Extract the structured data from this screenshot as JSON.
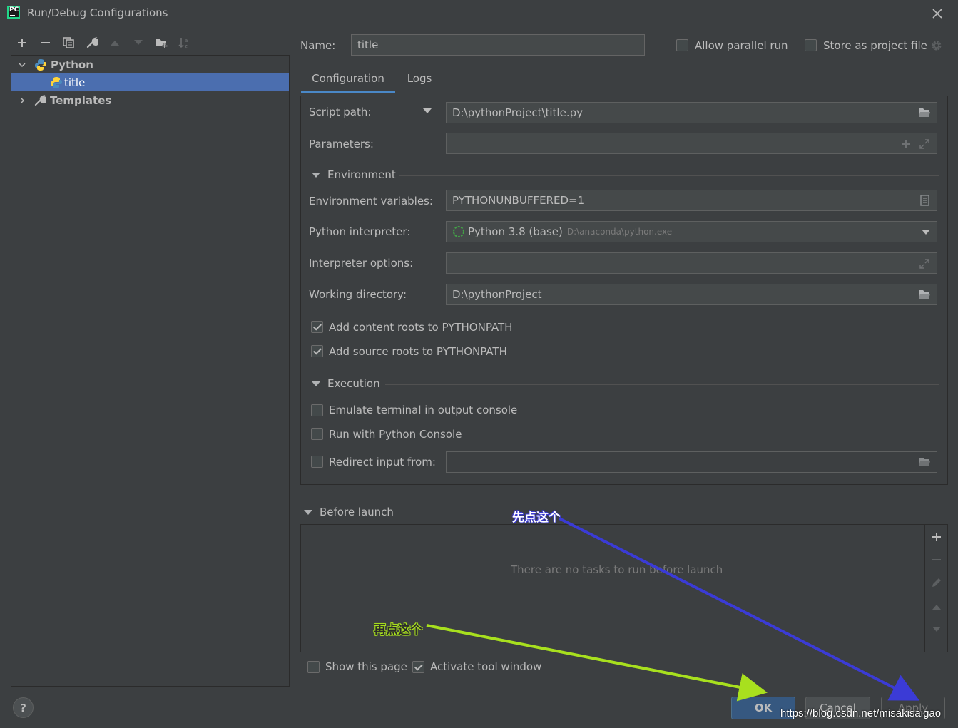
{
  "window": {
    "title": "Run/Debug Configurations",
    "app_logo": "PC"
  },
  "toolbar": {
    "icons": [
      "plus-icon",
      "minus-icon",
      "copy-icon",
      "wrench-icon",
      "arrow-up-icon",
      "arrow-down-icon",
      "folder-add-icon",
      "sort-icon"
    ]
  },
  "tree": {
    "python_label": "Python",
    "title_label": "title",
    "templates_label": "Templates"
  },
  "header": {
    "name_label": "Name:",
    "name_value": "title",
    "allow_parallel_label": "Allow parallel run",
    "store_as_project_label": "Store as project file"
  },
  "tabs": [
    {
      "label": "Configuration",
      "active": true
    },
    {
      "label": "Logs",
      "active": false
    }
  ],
  "form": {
    "script_path_label": "Script path:",
    "script_path_value": "D:\\pythonProject\\title.py",
    "parameters_label": "Parameters:",
    "parameters_value": "",
    "environment_section": "Environment",
    "env_vars_label": "Environment variables:",
    "env_vars_value": "PYTHONUNBUFFERED=1",
    "interpreter_label": "Python interpreter:",
    "interpreter_name": "Python 3.8 (base)",
    "interpreter_path": "D:\\anaconda\\python.exe",
    "interp_options_label": "Interpreter options:",
    "interp_options_value": "",
    "working_dir_label": "Working directory:",
    "working_dir_value": "D:\\pythonProject",
    "add_content_roots_label": "Add content roots to PYTHONPATH",
    "add_source_roots_label": "Add source roots to PYTHONPATH",
    "execution_section": "Execution",
    "emulate_terminal_label": "Emulate terminal in output console",
    "run_python_console_label": "Run with Python Console",
    "redirect_input_label": "Redirect input from:",
    "redirect_input_value": ""
  },
  "before_launch": {
    "title": "Before launch",
    "empty_text": "There are no tasks to run before launch"
  },
  "footer": {
    "show_page_label": "Show this page",
    "activate_tool_label": "Activate tool window",
    "ok_label": "OK",
    "cancel_label": "Cancel",
    "apply_label": "Apply",
    "help_label": "?"
  },
  "annotations": {
    "first_click": "先点这个",
    "second_click": "再点这个",
    "watermark": "https://blog.csdn.net/misakisaigao"
  },
  "colors": {
    "background": "#3c3f41",
    "selection": "#4b6eaf",
    "tab_underline": "#4a88c7",
    "arrow_blue": "#3b3bd6",
    "arrow_green": "#a8e01e"
  }
}
